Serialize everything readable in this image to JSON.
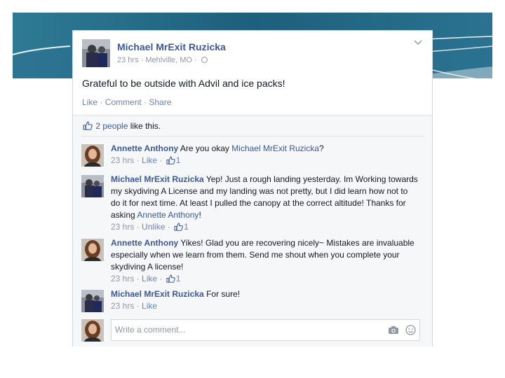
{
  "colors": {
    "slide_blue": "#1f5f7a",
    "fb_blue": "#3b5998",
    "fb_link": "#6d84b4",
    "meta_gray": "#9197a3"
  },
  "post": {
    "author": "Michael MrExit Ruzicka",
    "time": "23 hrs",
    "location": "Mehlville, MO",
    "status": "Grateful to be outside with Advil and ice packs!",
    "actions": {
      "like": "Like",
      "comment": "Comment",
      "share": "Share"
    },
    "likes": {
      "count_text": "2 people",
      "suffix": " like this."
    }
  },
  "comments": [
    {
      "author": "Annette Anthony",
      "text": "Are you okay",
      "mention": "Michael MrExit Ruzicka",
      "text_after": "?",
      "time": "23 hrs",
      "action": "Like",
      "likes": "1",
      "avatar": "annette-photo"
    },
    {
      "author": "Michael MrExit Ruzicka",
      "text": "Yep! Just a rough landing yesterday. Im Working towards my skydiving A License and my landing was not pretty, but I did learn how not to do it for next time. At least I pulled the canopy at the correct altitude! Thanks for asking",
      "mention": "Annette Anthony",
      "text_after": "!",
      "time": "23 hrs",
      "action": "Unlike",
      "likes": "1",
      "avatar": "michael-photo"
    },
    {
      "author": "Annette Anthony",
      "text": "Yikes! Glad you are recovering nicely~ Mistakes are invaluable especially when we learn from them. Send me shout when you complete your skydiving A license!",
      "time": "23 hrs",
      "action": "Like",
      "likes": "1",
      "avatar": "annette-photo"
    },
    {
      "author": "Michael MrExit Ruzicka",
      "text": "For sure!",
      "time": "23 hrs",
      "action": "Like",
      "avatar": "michael-photo"
    }
  ],
  "composer": {
    "placeholder": "Write a comment...",
    "camera_icon": "camera-icon",
    "emoji_icon": "smiley-icon"
  }
}
